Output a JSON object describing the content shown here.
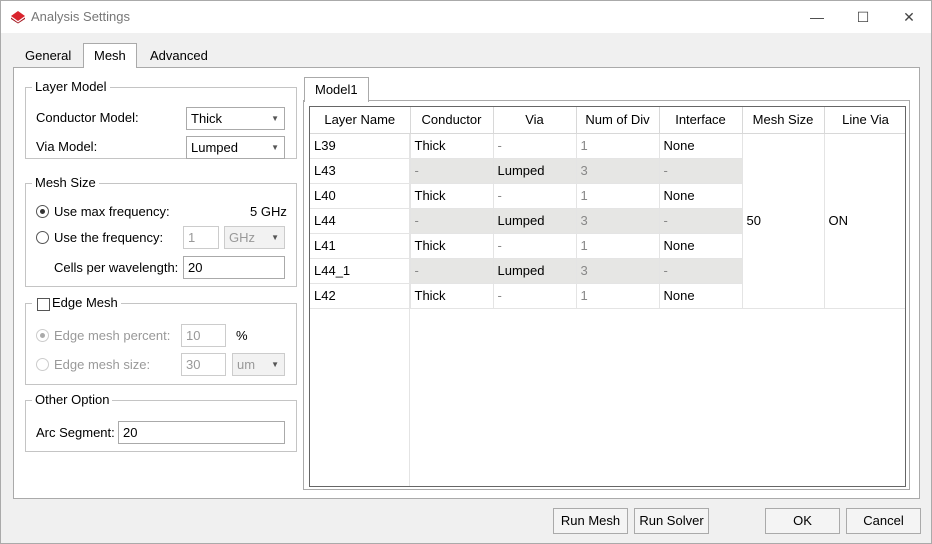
{
  "window": {
    "title": "Analysis Settings",
    "minimize_glyph": "—",
    "maximize_glyph": "☐",
    "close_glyph": "✕",
    "icon_color": "#d9232d"
  },
  "tabs": [
    "General",
    "Mesh",
    "Advanced"
  ],
  "layer_model": {
    "title": "Layer Model",
    "conductor_label": "Conductor Model:",
    "conductor_value": "Thick",
    "via_label": "Via Model:",
    "via_value": "Lumped"
  },
  "mesh_size": {
    "title": "Mesh Size",
    "use_max_label": "Use max frequency:",
    "max_freq_value": "5 GHz",
    "use_freq_label": "Use the frequency:",
    "freq_value": "1",
    "freq_unit": "GHz",
    "cells_label": "Cells per wavelength:",
    "cells_value": "20"
  },
  "edge_mesh": {
    "title": "Edge Mesh",
    "percent_label": "Edge mesh percent:",
    "percent_value": "10",
    "percent_unit": "%",
    "size_label": "Edge mesh size:",
    "size_value": "30",
    "size_unit": "um"
  },
  "other_option": {
    "title": "Other Option",
    "arc_label": "Arc Segment:",
    "arc_value": "20"
  },
  "model_tab": "Model1",
  "table": {
    "headers": [
      "Layer Name",
      "Conductor",
      "Via",
      "Num of Div",
      "Interface",
      "Mesh Size",
      "Line Via"
    ],
    "rows": [
      [
        "L39",
        "Thick",
        "-",
        "1",
        "None"
      ],
      [
        "L43",
        "-",
        "Lumped",
        "3",
        "-"
      ],
      [
        "L40",
        "Thick",
        "-",
        "1",
        "None"
      ],
      [
        "L44",
        "-",
        "Lumped",
        "3",
        "-"
      ],
      [
        "L41",
        "Thick",
        "-",
        "1",
        "None"
      ],
      [
        "L44_1",
        "-",
        "Lumped",
        "3",
        "-"
      ],
      [
        "L42",
        "Thick",
        "-",
        "1",
        "None"
      ]
    ],
    "mesh_size": "50",
    "line_via": "ON"
  },
  "buttons": {
    "run_mesh": "Run Mesh",
    "run_solver": "Run Solver",
    "ok": "OK",
    "cancel": "Cancel"
  }
}
